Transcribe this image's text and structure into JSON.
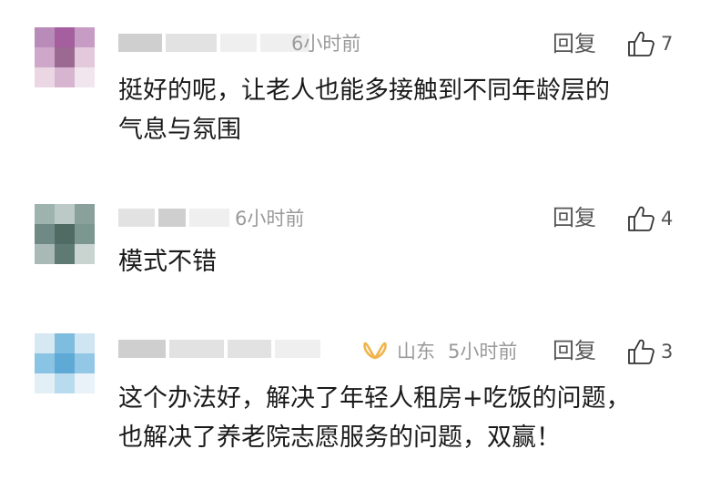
{
  "comments": [
    {
      "time": "6小时前",
      "location": "",
      "text_lines": [
        "挺好的呢，让老人也能多接触到不同年龄层的",
        "气息与氛围"
      ],
      "reply_label": "回复",
      "like_count": "7",
      "like_icon": "thumbs-up-icon"
    },
    {
      "time": "6小时前",
      "location": "",
      "text_lines": [
        "模式不错"
      ],
      "reply_label": "回复",
      "like_count": "4",
      "like_icon": "thumbs-up-icon"
    },
    {
      "time": "5小时前",
      "location": "山东",
      "text_lines": [
        "这个办法好，解决了年轻人租房+吃饭的问题，",
        "也解决了养老院志愿服务的问题，双赢！"
      ],
      "reply_label": "回复",
      "like_count": "3",
      "like_icon": "thumbs-up-icon",
      "badge_icon": "vip-badge-icon"
    }
  ],
  "colors": {
    "text": "#1a1a1a",
    "meta": "#9a9a9a",
    "action": "#555555",
    "badge": "#f0b44c"
  }
}
